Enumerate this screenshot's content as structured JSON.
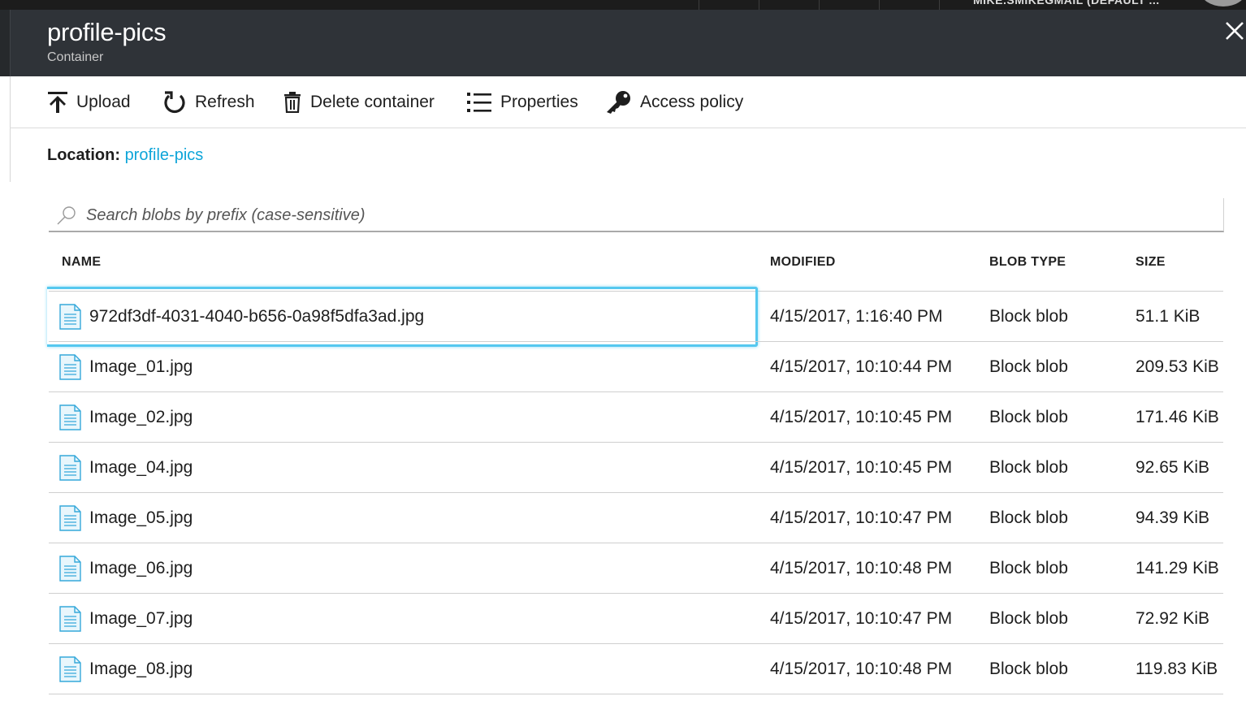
{
  "topbar": {
    "account": "MIKE.SMIKEGMAIL (DEFAULT ..."
  },
  "header": {
    "title": "profile-pics",
    "subtitle": "Container"
  },
  "toolbar": {
    "upload": "Upload",
    "refresh": "Refresh",
    "delete": "Delete container",
    "properties": "Properties",
    "access": "Access policy"
  },
  "location": {
    "label": "Location:",
    "link": "profile-pics"
  },
  "search": {
    "placeholder": "Search blobs by prefix (case-sensitive)",
    "value": ""
  },
  "table": {
    "columns": {
      "name": "NAME",
      "modified": "MODIFIED",
      "type": "BLOB TYPE",
      "size": "SIZE"
    },
    "rows": [
      {
        "name": "972df3df-4031-4040-b656-0a98f5dfa3ad.jpg",
        "modified": "4/15/2017, 1:16:40 PM",
        "type": "Block blob",
        "size": "51.1 KiB"
      },
      {
        "name": "Image_01.jpg",
        "modified": "4/15/2017, 10:10:44 PM",
        "type": "Block blob",
        "size": "209.53 KiB"
      },
      {
        "name": "Image_02.jpg",
        "modified": "4/15/2017, 10:10:45 PM",
        "type": "Block blob",
        "size": "171.46 KiB"
      },
      {
        "name": "Image_04.jpg",
        "modified": "4/15/2017, 10:10:45 PM",
        "type": "Block blob",
        "size": "92.65 KiB"
      },
      {
        "name": "Image_05.jpg",
        "modified": "4/15/2017, 10:10:47 PM",
        "type": "Block blob",
        "size": "94.39 KiB"
      },
      {
        "name": "Image_06.jpg",
        "modified": "4/15/2017, 10:10:48 PM",
        "type": "Block blob",
        "size": "141.29 KiB"
      },
      {
        "name": "Image_07.jpg",
        "modified": "4/15/2017, 10:10:47 PM",
        "type": "Block blob",
        "size": "72.92 KiB"
      },
      {
        "name": "Image_08.jpg",
        "modified": "4/15/2017, 10:10:48 PM",
        "type": "Block blob",
        "size": "119.83 KiB"
      }
    ]
  },
  "icons": {
    "file": "file-icon",
    "search": "search-icon",
    "close": "close-icon"
  },
  "colors": {
    "header_bg": "#2f3338",
    "link": "#0ea5d9",
    "selection": "#55c8ef"
  }
}
